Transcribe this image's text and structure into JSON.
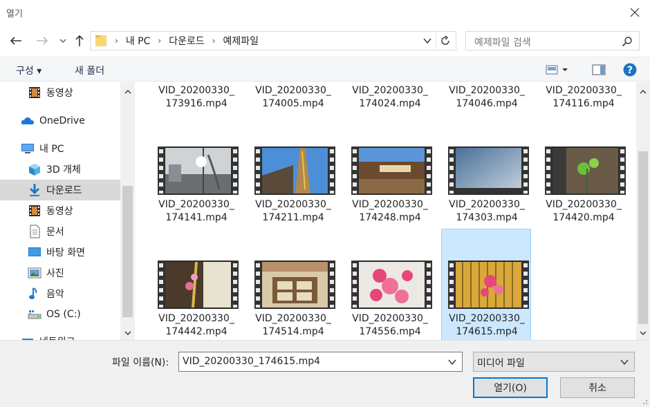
{
  "window": {
    "title": "열기"
  },
  "address": {
    "crumbs": [
      "내 PC",
      "다운로드",
      "예제파일"
    ]
  },
  "search": {
    "placeholder": "예제파일 검색"
  },
  "toolbar": {
    "organize": "구성 ▾",
    "new_folder": "새 폴더"
  },
  "nav": {
    "items": [
      {
        "label": "동영상",
        "icon": "video-icon"
      },
      {
        "label": "OneDrive",
        "icon": "cloud-icon"
      },
      {
        "label": "내 PC",
        "icon": "pc-icon"
      },
      {
        "label": "3D 개체",
        "icon": "cube-icon"
      },
      {
        "label": "다운로드",
        "icon": "download-icon",
        "selected": true
      },
      {
        "label": "동영상",
        "icon": "video-icon"
      },
      {
        "label": "문서",
        "icon": "document-icon"
      },
      {
        "label": "바탕 화면",
        "icon": "desktop-icon"
      },
      {
        "label": "사진",
        "icon": "picture-icon"
      },
      {
        "label": "음악",
        "icon": "music-icon"
      },
      {
        "label": "OS (C:)",
        "icon": "drive-icon"
      },
      {
        "label": "네트워크",
        "icon": "network-icon"
      }
    ]
  },
  "files": [
    {
      "line1": "VID_20200330_",
      "line2": "173916.mp4"
    },
    {
      "line1": "VID_20200330_",
      "line2": "174005.mp4"
    },
    {
      "line1": "VID_20200330_",
      "line2": "174024.mp4"
    },
    {
      "line1": "VID_20200330_",
      "line2": "174046.mp4"
    },
    {
      "line1": "VID_20200330_",
      "line2": "174116.mp4"
    },
    {
      "line1": "VID_20200330_",
      "line2": "174141.mp4"
    },
    {
      "line1": "VID_20200330_",
      "line2": "174211.mp4"
    },
    {
      "line1": "VID_20200330_",
      "line2": "174248.mp4"
    },
    {
      "line1": "VID_20200330_",
      "line2": "174303.mp4"
    },
    {
      "line1": "VID_20200330_",
      "line2": "174420.mp4"
    },
    {
      "line1": "VID_20200330_",
      "line2": "174442.mp4"
    },
    {
      "line1": "VID_20200330_",
      "line2": "174514.mp4"
    },
    {
      "line1": "VID_20200330_",
      "line2": "174556.mp4"
    },
    {
      "line1": "VID_20200330_",
      "line2": "174615.mp4",
      "selected": true
    }
  ],
  "footer": {
    "filename_label": "파일 이름(N):",
    "filename_value": "VID_20200330_174615.mp4",
    "filetype_value": "미디어 파일",
    "open_label": "열기(O)",
    "cancel_label": "취소"
  },
  "colors": {
    "accent": "#0078d7",
    "selection": "#cce8ff",
    "help": "#1e73c7"
  }
}
